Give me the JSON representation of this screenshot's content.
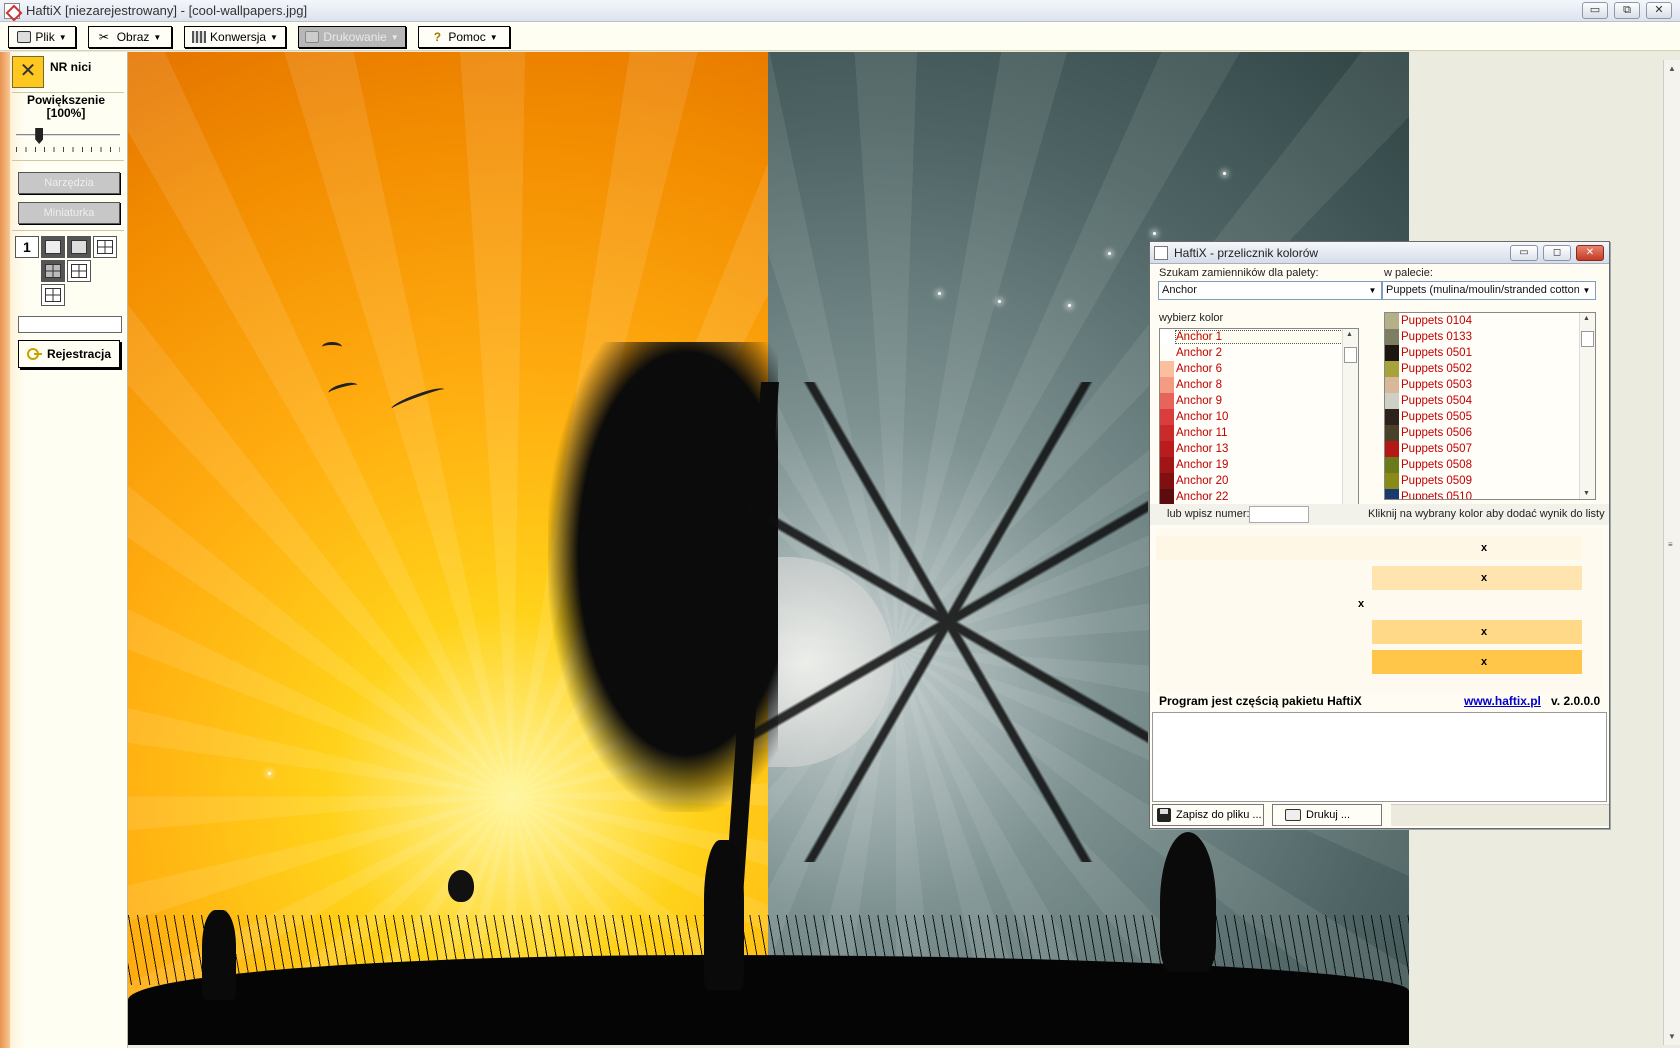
{
  "window": {
    "title": "HaftiX [niezarejestrowany] - [cool-wallpapers.jpg]",
    "minimize": "▭",
    "restore": "⧉",
    "close": "✕"
  },
  "menu": {
    "items": [
      {
        "label": "Plik",
        "icon": "printer-icon"
      },
      {
        "label": "Obraz",
        "icon": "scissors-icon"
      },
      {
        "label": "Konwersja",
        "icon": "grid-icon"
      },
      {
        "label": "Drukowanie",
        "icon": "printer-icon",
        "disabled": true
      },
      {
        "label": "Pomoc",
        "icon": "question-icon"
      }
    ]
  },
  "sidebar": {
    "nr_label": "NR nici",
    "nr_symbol": "✕",
    "zoom_label": "Powiększenie",
    "zoom_value": "[100%]",
    "zoom_fraction": 0.2,
    "tools_button": "Narzędzia",
    "thumb_button": "Miniaturka",
    "register_button": "Rejestracja"
  },
  "dialog": {
    "title": "HaftiX - przelicznik kolorów",
    "search_label": "Szukam zamienników dla palety:",
    "search_value": "Anchor",
    "in_palette_label": "w palecie:",
    "in_palette_value": "Puppets (mulina/moulin/stranded cotton)",
    "choose_label": "wybierz kolor",
    "number_label": "lub wpisz numer:",
    "hint": "Kliknij na wybrany kolor aby dodać wynik do listy",
    "left_list": [
      {
        "name": "Anchor 1",
        "color": "#ffffff"
      },
      {
        "name": "Anchor 2",
        "color": "#fffdf8"
      },
      {
        "name": "Anchor 6",
        "color": "#fbbfa0"
      },
      {
        "name": "Anchor 8",
        "color": "#f49c83"
      },
      {
        "name": "Anchor 9",
        "color": "#e6645a"
      },
      {
        "name": "Anchor 10",
        "color": "#d93d3d"
      },
      {
        "name": "Anchor 11",
        "color": "#c92a2a"
      },
      {
        "name": "Anchor 13",
        "color": "#b81c1c"
      },
      {
        "name": "Anchor 19",
        "color": "#a01616"
      },
      {
        "name": "Anchor 20",
        "color": "#801010"
      },
      {
        "name": "Anchor 22",
        "color": "#5c0c0c"
      }
    ],
    "right_list": [
      {
        "name": "Puppets 0104",
        "color": "#b3b08a"
      },
      {
        "name": "Puppets 0133",
        "color": "#7e7e63"
      },
      {
        "name": "Puppets 0501",
        "color": "#1e1410"
      },
      {
        "name": "Puppets 0502",
        "color": "#a8a23a"
      },
      {
        "name": "Puppets 0503",
        "color": "#d9b89a"
      },
      {
        "name": "Puppets 0504",
        "color": "#cfcfc6"
      },
      {
        "name": "Puppets 0505",
        "color": "#2e231c"
      },
      {
        "name": "Puppets 0506",
        "color": "#494228"
      },
      {
        "name": "Puppets 0507",
        "color": "#b31a16"
      },
      {
        "name": "Puppets 0508",
        "color": "#6b7a1a"
      },
      {
        "name": "Puppets 0509",
        "color": "#8a8a18"
      },
      {
        "name": "Puppets 0510",
        "color": "#1a3a6e"
      }
    ],
    "results": {
      "marks": [
        "x",
        "x",
        "x",
        "x",
        "x"
      ]
    },
    "footer_text": "Program jest częścią pakietu HaftiX",
    "footer_link": "www.haftix.pl",
    "version": "v. 2.0.0.0",
    "save_button": "Zapisz do pliku ...",
    "print_button": "Drukuj ...",
    "ctl_min": "▭",
    "ctl_max": "◻",
    "ctl_close": "✕"
  }
}
